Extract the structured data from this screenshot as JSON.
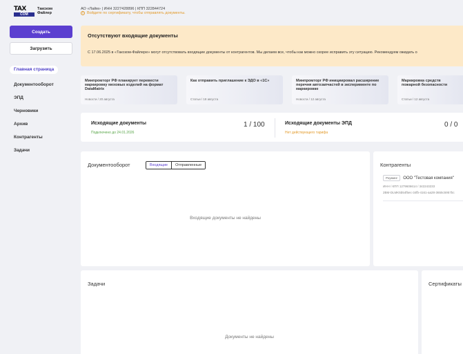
{
  "brand": {
    "logo_tax": "TAX",
    "logo_com": "COM",
    "name_line1": "Такском",
    "name_line2": "Файлер"
  },
  "org": {
    "info": "АО «Лайм» | ИНН 3227428896 | КПП 322844724",
    "warning": "Войдите по сертификату, чтобы отправлять документы.",
    "warning_icon": "info-icon"
  },
  "sidebar": {
    "create_label": "Создать",
    "upload_label": "Загрузить",
    "items": [
      {
        "label": "Главная страница",
        "active": true
      },
      {
        "label": "Документооборот"
      },
      {
        "label": "ЭПД"
      },
      {
        "label": "Черновики"
      },
      {
        "label": "Архив"
      },
      {
        "label": "Контрагенты"
      },
      {
        "label": "Задачи"
      }
    ]
  },
  "alert": {
    "title": "Отсутствуют входящие документы",
    "text": "С 17.06.2025 в «Такском-Файлере» могут отсутствовать входящие документы от контрагентов. Мы делаем все, чтобы как можно скорее исправить эту ситуацию. Рекомендуем ожидать о"
  },
  "news": [
    {
      "title": "Минпромторг РФ планирует перевести маркировку меховых изделий на формат DataMatrix",
      "meta": "Новости / 20 августа"
    },
    {
      "title": "Как отправить приглашение к ЭДО в «1С»",
      "meta": "Статьи / 18 августа"
    },
    {
      "title": "Минпромторг РФ инициировал расширение перечня автозапчастей в эксперименте по маркировке",
      "meta": "Новости / 12 августа"
    },
    {
      "title": "Маркировка средств пожарной безопасности",
      "meta": "Статьи / 12 августа"
    }
  ],
  "stats": {
    "outgoing": {
      "title": "Исходящие документы",
      "sub": "Подключено до 24.01.2026",
      "count": "1 / 100",
      "sub_color": "#5aa64a"
    },
    "outgoing_epd": {
      "title": "Исходящие документы ЭПД",
      "sub": "Нет действующего тарифа",
      "count": "0 / 0",
      "sub_color": "#e29a2a"
    }
  },
  "docflow": {
    "title": "Документооборот",
    "tab_incoming": "Входящие",
    "tab_sent": "Отправленные",
    "empty": "Входящие документы не найдены"
  },
  "contractors": {
    "title": "Контрагенты",
    "badge": "Роуминг",
    "name": "ООО \"Тестовая компания\"",
    "inn_line": "ИНН / КПП   1279606614 / 342243233",
    "id_line": "2BM-DLMK5b54f5ec-34fb-4161-aa28-3655c5957bc"
  },
  "tasks": {
    "title": "Задачи",
    "empty": "Документы не найдены"
  },
  "certificates": {
    "title": "Сертификаты"
  },
  "colors": {
    "accent": "#5b3fd0",
    "alert_bg": "#fde9c8",
    "warning": "#e29a2a",
    "success": "#5aa64a"
  }
}
